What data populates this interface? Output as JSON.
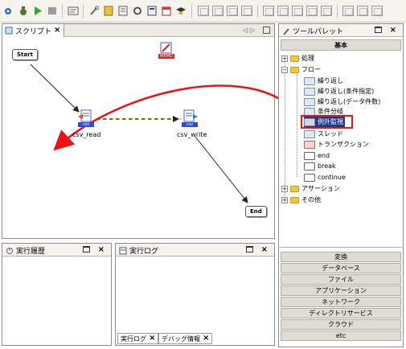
{
  "toolbar": {
    "items": [
      "save-icon",
      "debug-icon",
      "run-icon",
      "stop-icon",
      "log-icon",
      "wrench-icon",
      "book-icon",
      "document-icon",
      "settings-icon",
      "calculator-icon",
      "calendar-icon",
      "cap-icon"
    ]
  },
  "script_panel": {
    "tab_label": "スクリプト",
    "nodes": {
      "start": "Start",
      "end": "End",
      "memo": "MEMO",
      "csv_read": "csv_read",
      "csv_write": "csv_write",
      "csv_tag": "csv"
    }
  },
  "palette": {
    "title": "ツールパレット",
    "header": "基本",
    "tree": {
      "shori": "処理",
      "flow": "フロー",
      "kurikaeshi": "繰り返し",
      "kurikaeshi_jouken": "繰り返し(条件指定)",
      "kurikaeshi_data": "繰り返し(データ件数)",
      "jouken_bunki": "条件分岐",
      "reigai_kanshi": "例外監視",
      "thread": "スレッド",
      "transaction": "トランザクション",
      "end": "end",
      "break": "break",
      "continue": "continue",
      "assertion": "アサーション",
      "sonota": "その他"
    },
    "sections": [
      "変換",
      "データベース",
      "ファイル",
      "アプリケーション",
      "ネットワーク",
      "ディレクトリサービス",
      "クラウド",
      "etc"
    ]
  },
  "history_panel": {
    "title": "実行履歴"
  },
  "log_panel": {
    "title": "実行ログ",
    "tabs": {
      "log": "実行ログ",
      "debug": "デバッグ情報"
    }
  },
  "colors": {
    "annotation_red": "#ee1111",
    "highlight_box": "#1f3a8a",
    "section_bg": "#dedcd4"
  }
}
